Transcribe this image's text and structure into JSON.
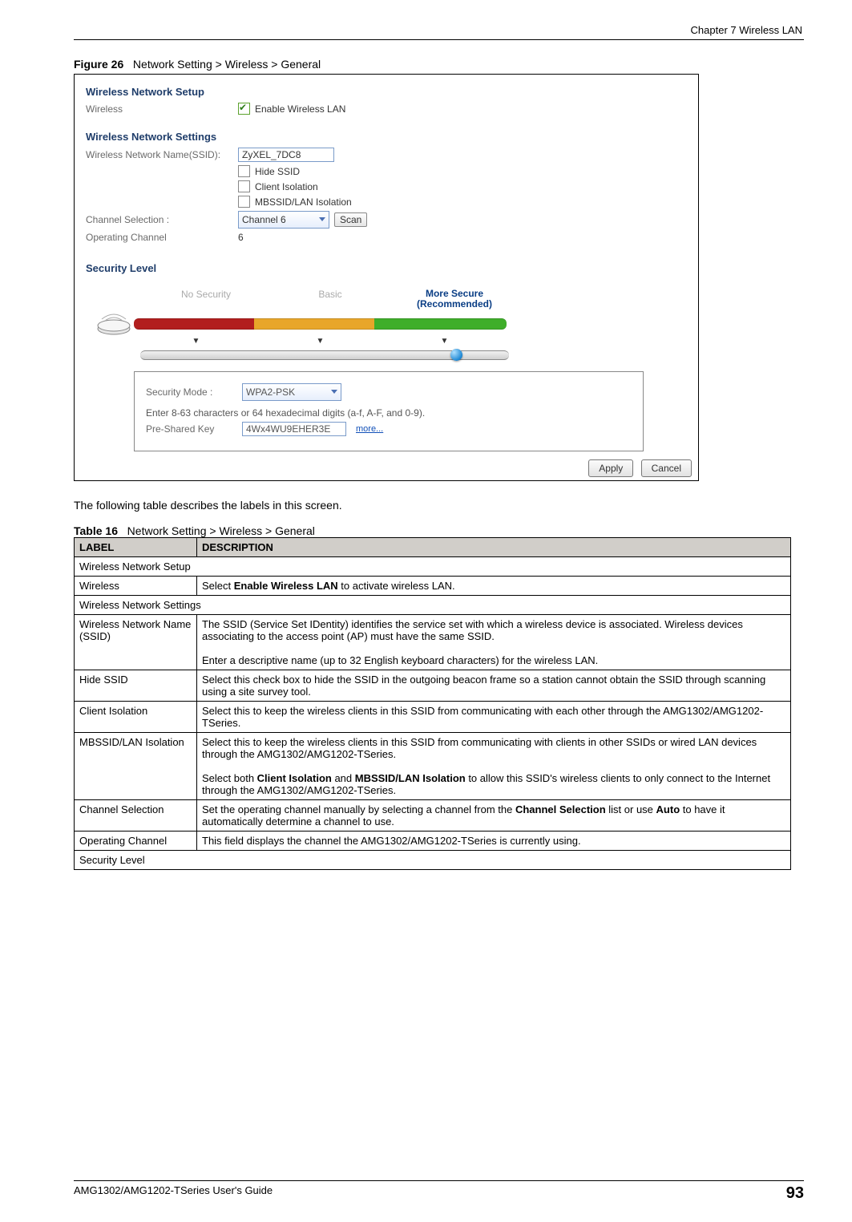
{
  "header": {
    "chapter": "Chapter 7 Wireless LAN"
  },
  "figure": {
    "number": "Figure 26",
    "caption": "Network Setting > Wireless > General"
  },
  "screenshot": {
    "section_setup": "Wireless Network Setup",
    "wireless_label": "Wireless",
    "enable_wlan": "Enable Wireless LAN",
    "section_settings": "Wireless Network Settings",
    "ssid_label": "Wireless Network Name(SSID):",
    "ssid_value": "ZyXEL_7DC8",
    "hide_ssid": "Hide SSID",
    "client_iso": "Client Isolation",
    "mbssid_iso": "MBSSID/LAN Isolation",
    "chan_sel_label": "Channel Selection :",
    "chan_sel_value": "Channel 6",
    "scan_btn": "Scan",
    "op_chan_label": "Operating Channel",
    "op_chan_value": "6",
    "section_security": "Security Level",
    "sl_no": "No Security",
    "sl_basic": "Basic",
    "sl_more_l1": "More Secure",
    "sl_more_l2": "(Recommended)",
    "sec_mode_label": "Security Mode :",
    "sec_mode_value": "WPA2-PSK",
    "sec_hint": "Enter 8-63 characters or 64 hexadecimal digits (a-f, A-F, and 0-9).",
    "psk_label": "Pre-Shared Key",
    "psk_value": "4Wx4WU9EHER3E",
    "more_link": "more...",
    "apply_btn": "Apply",
    "cancel_btn": "Cancel"
  },
  "post_caption": "The following table describes the labels in this screen.",
  "table": {
    "number": "Table 16",
    "caption": "Network Setting > Wireless > General",
    "head_label": "LABEL",
    "head_desc": "DESCRIPTION",
    "rows": [
      {
        "section": "Wireless Network Setup"
      },
      {
        "label": "Wireless",
        "desc": "Select <b>Enable Wireless LAN</b> to activate wireless LAN."
      },
      {
        "section": "Wireless Network Settings"
      },
      {
        "label": "Wireless Network Name (SSID)",
        "desc": "The SSID (Service Set IDentity) identifies the service set with which a wireless device is associated. Wireless devices associating to the access point (AP) must have the same SSID.<br><br>Enter a descriptive name (up to 32 English keyboard characters) for the wireless LAN."
      },
      {
        "label": "Hide SSID",
        "desc": "Select this check box to hide the SSID in the outgoing beacon frame so a station cannot obtain the SSID through scanning using a site survey tool."
      },
      {
        "label": "Client Isolation",
        "desc": "Select this to keep the wireless clients in this SSID from communicating with each other through the AMG1302/AMG1202-TSeries."
      },
      {
        "label": "MBSSID/LAN Isolation",
        "desc": "Select this to keep the wireless clients in this SSID from communicating with clients in other SSIDs or wired LAN devices through the AMG1302/AMG1202-TSeries.<br><br>Select both <b>Client Isolation</b> and <b>MBSSID/LAN Isolation</b> to allow this SSID's wireless clients to only connect to the Internet through the AMG1302/AMG1202-TSeries."
      },
      {
        "label": "Channel Selection",
        "desc": "Set the operating channel manually by selecting a channel from the <b>Channel Selection</b> list or use <b>Auto</b> to have it automatically determine a channel to use."
      },
      {
        "label": "Operating Channel",
        "desc": "This field displays the channel the AMG1302/AMG1202-TSeries is currently using."
      },
      {
        "section": "Security Level"
      }
    ]
  },
  "footer": {
    "guide": "AMG1302/AMG1202-TSeries User's Guide",
    "page": "93"
  }
}
